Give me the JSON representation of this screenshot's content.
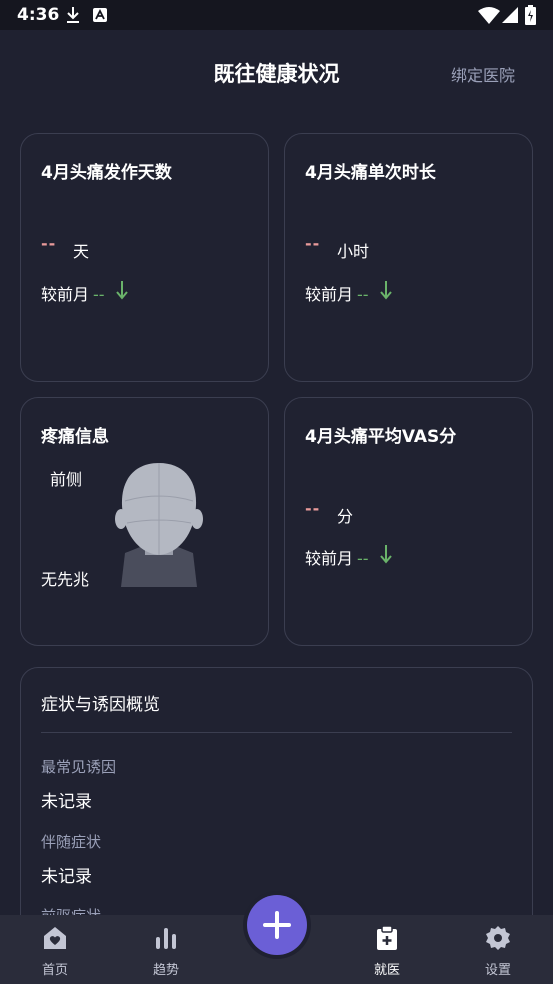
{
  "status_bar": {
    "time": "4:36"
  },
  "header": {
    "title": "既往健康状况",
    "action": "绑定医院"
  },
  "cards": {
    "headache_days": {
      "title": "4月头痛发作天数",
      "value": "--",
      "unit": "天",
      "compare_label": "较前月",
      "compare_value": "--"
    },
    "headache_duration": {
      "title": "4月头痛单次时长",
      "value": "--",
      "unit": "小时",
      "compare_label": "较前月",
      "compare_value": "--"
    },
    "pain_info": {
      "title": "疼痛信息",
      "location": "前侧",
      "aura": "无先兆"
    },
    "vas": {
      "title": "4月头痛平均VAS分",
      "value": "--",
      "unit": "分",
      "compare_label": "较前月",
      "compare_value": "--"
    }
  },
  "symptoms": {
    "title": "症状与诱因概览",
    "fields": [
      {
        "label": "最常见诱因",
        "value": "未记录"
      },
      {
        "label": "伴随症状",
        "value": "未记录"
      },
      {
        "label": "前驱症状",
        "value": ""
      }
    ]
  },
  "nav": {
    "items": [
      {
        "label": "首页",
        "icon": "home-heart-icon"
      },
      {
        "label": "趋势",
        "icon": "bar-chart-icon"
      },
      {
        "label": "就医",
        "icon": "clipboard-plus-icon"
      },
      {
        "label": "设置",
        "icon": "gear-icon"
      }
    ],
    "active": "就医"
  },
  "colors": {
    "background": "#1f2130",
    "accent": "#6b5fd6",
    "dash": "#e89a9a",
    "down": "#6ab36a"
  }
}
